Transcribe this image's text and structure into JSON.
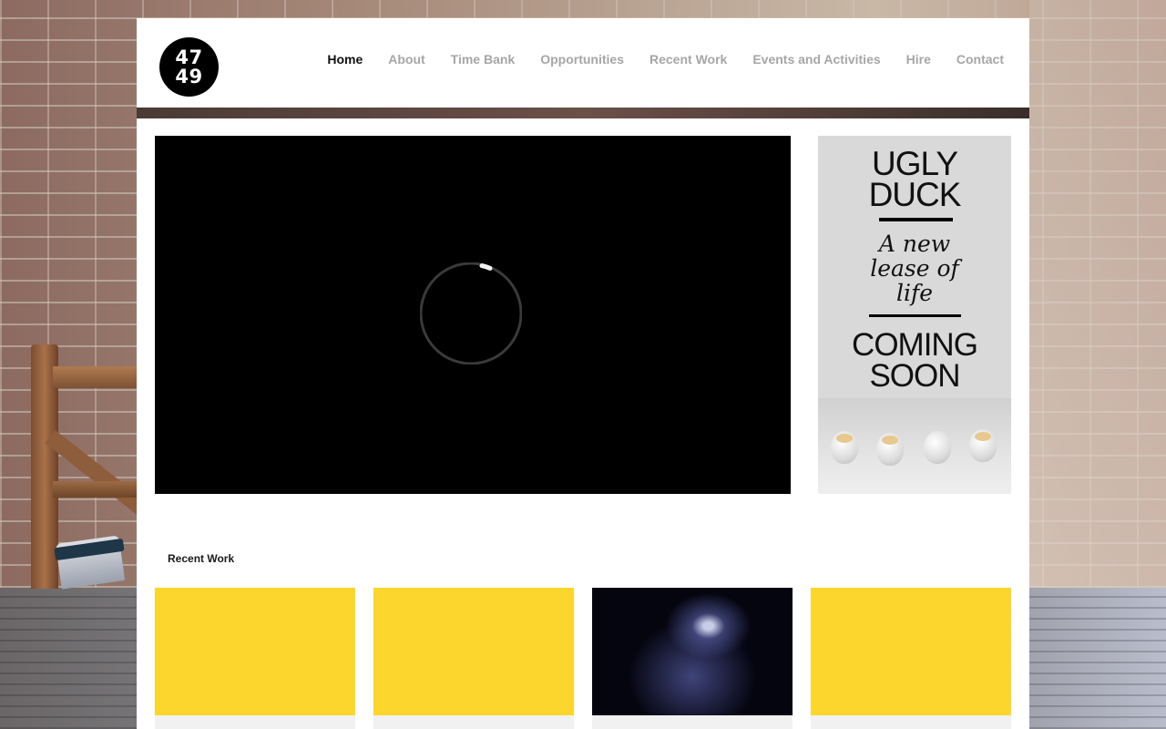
{
  "logo": {
    "line1": "47",
    "line2": "49"
  },
  "nav": {
    "items": [
      {
        "label": "Home",
        "active": true
      },
      {
        "label": "About"
      },
      {
        "label": "Time Bank"
      },
      {
        "label": "Opportunities"
      },
      {
        "label": "Recent Work"
      },
      {
        "label": "Events and Activities"
      },
      {
        "label": "Hire"
      },
      {
        "label": "Contact"
      }
    ]
  },
  "ad": {
    "title_line1": "UGLY",
    "title_line2": "DUCK",
    "tagline_line1": "A new",
    "tagline_line2": "lease of",
    "tagline_line3": "life",
    "coming_line1": "COMING",
    "coming_line2": "SOON"
  },
  "recent_work": {
    "heading": "Recent Work"
  },
  "colors": {
    "accent_yellow": "#fcd52d",
    "nav_active": "#111111",
    "nav_inactive": "#a6a6a6"
  },
  "icons": {
    "loading": "loading-spinner-icon"
  }
}
